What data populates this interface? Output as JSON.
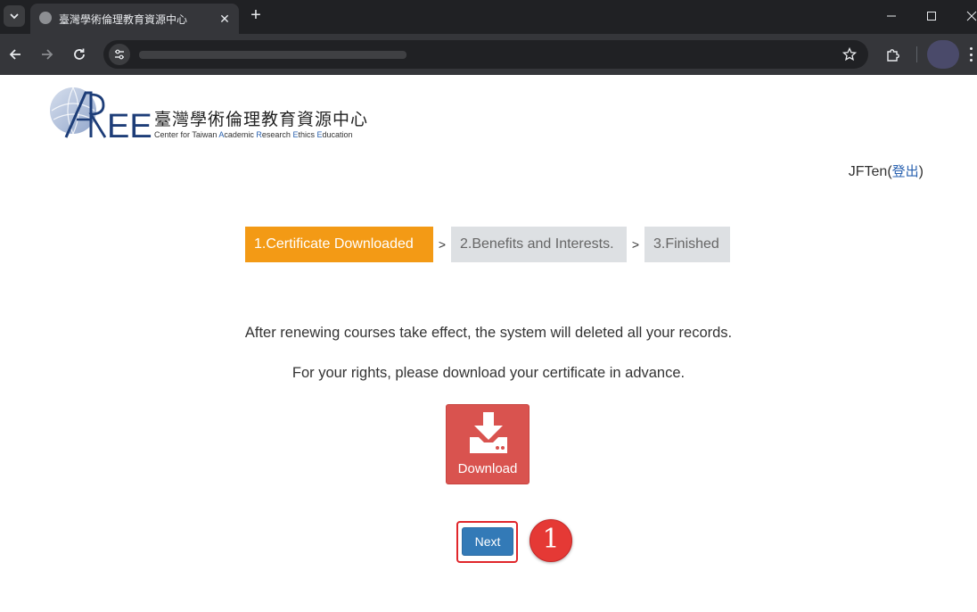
{
  "browser": {
    "tab_title": "臺灣學術倫理教育資源中心",
    "new_tab_label": "+",
    "close_tab_label": "✕"
  },
  "site": {
    "logo_text": "AREE",
    "name_cn": "臺灣學術倫理教育資源中心",
    "name_en_parts": [
      "Center for Taiwan ",
      "A",
      "cademic ",
      "R",
      "esearch ",
      "E",
      "thics ",
      "E",
      "ducation"
    ]
  },
  "user": {
    "name": "JFTen",
    "logout_open": "(",
    "logout_label": "登出",
    "logout_close": ")"
  },
  "steps": [
    {
      "label": "1.Certificate Downloaded",
      "active": true
    },
    {
      "label": "2.Benefits and Interests.",
      "active": false
    },
    {
      "label": "3.Finished",
      "active": false
    }
  ],
  "step_separator": ">",
  "messages": {
    "line1": "After renewing courses take effect, the system will deleted all your records.",
    "line2": "For your rights, please download your certificate in advance."
  },
  "download": {
    "label": "Download",
    "icon": "download-icon"
  },
  "next": {
    "label": "Next"
  },
  "annotation": {
    "number": "1"
  },
  "colors": {
    "active_step": "#f39a15",
    "inactive_step": "#dde0e3",
    "download_button": "#d9534f",
    "next_button": "#337ab7",
    "annotation_red": "#e53935",
    "link": "#2a62b0"
  }
}
